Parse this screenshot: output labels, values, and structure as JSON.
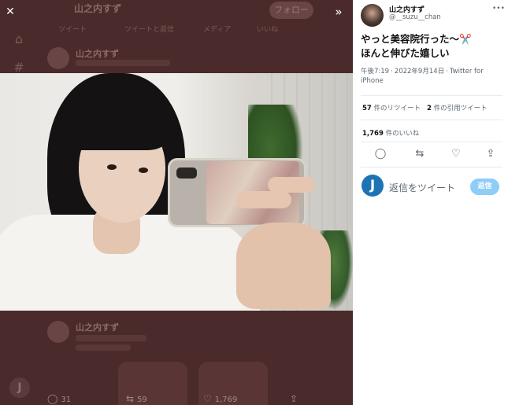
{
  "viewer": {
    "close_icon": "close-icon",
    "expand_icon": "chevron-double-right-icon"
  },
  "background": {
    "profile_name": "山之内すず",
    "follow_label": "フォロー",
    "tabs": [
      "ツイート",
      "ツイートと返信",
      "メディア",
      "いいね"
    ],
    "action_counts": {
      "replies": "31",
      "retweets": "59",
      "likes": "1,769"
    },
    "reply_badge": "J"
  },
  "panel": {
    "name": "山之内すず",
    "handle": "@__suzu__chan",
    "tweet_text": "やっと美容院行った〜✂️\nほんと伸びた嬉しい",
    "time": "午後7:19",
    "date": "2022年9月14日",
    "source": "Twitter for iPhone",
    "retweets": {
      "count": "57",
      "label": "件のリツイート"
    },
    "quotes": {
      "count": "2",
      "label": "件の引用ツイート"
    },
    "likes": {
      "count": "1,769",
      "label": "件のいいね"
    },
    "reply_avatar": "J",
    "reply_placeholder": "返信をツイート",
    "reply_button": "返信"
  },
  "icons": {
    "reply": "reply-icon",
    "retweet": "retweet-icon",
    "like": "heart-icon",
    "share": "share-icon",
    "more": "more-icon"
  }
}
